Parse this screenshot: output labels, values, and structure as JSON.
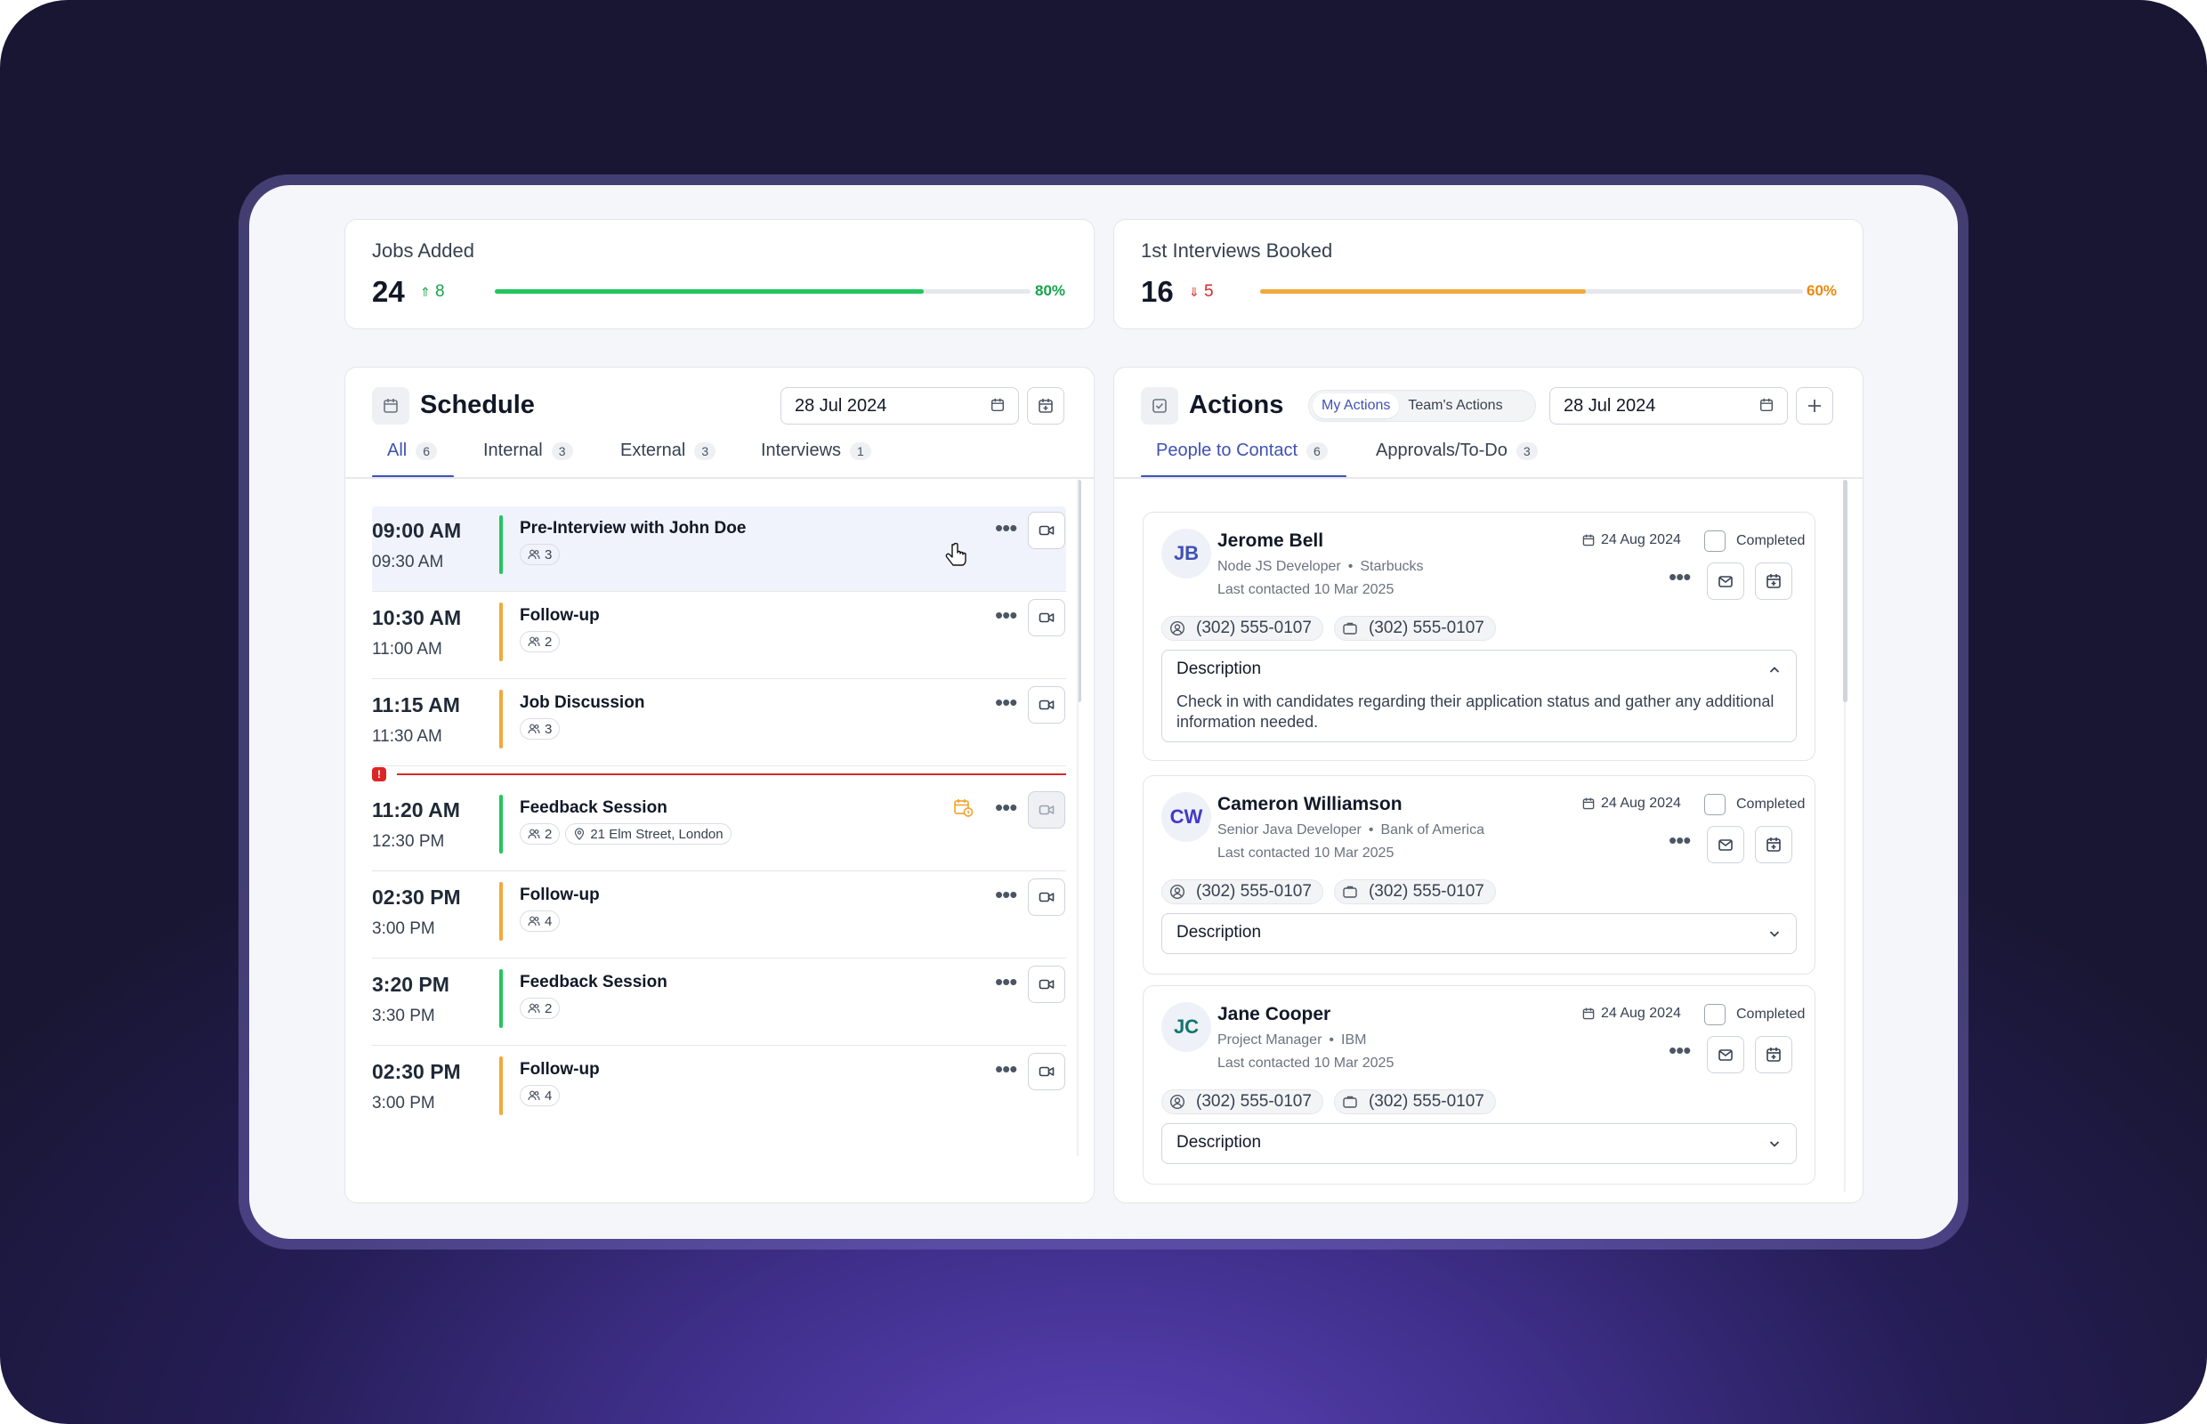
{
  "stats": [
    {
      "label": "Jobs Added",
      "value": "24",
      "delta": "8",
      "delta_dir": "up",
      "pct": "80%",
      "pct_value": 0.8,
      "color": "#22c55e"
    },
    {
      "label": "1st Interviews Booked",
      "value": "16",
      "delta": "5",
      "delta_dir": "down",
      "pct": "60%",
      "pct_value": 0.6,
      "color": "#f0a93b"
    }
  ],
  "schedule": {
    "title": "Schedule",
    "date": "28 Jul 2024",
    "tabs": [
      {
        "label": "All",
        "count": "6",
        "active": true
      },
      {
        "label": "Internal",
        "count": "3"
      },
      {
        "label": "External",
        "count": "3"
      },
      {
        "label": "Interviews",
        "count": "1"
      }
    ],
    "events": [
      {
        "start": "09:00 AM",
        "end": "09:30 AM",
        "title": "Pre-Interview with John Doe",
        "attendees": "3",
        "color": "#22c55e",
        "highlight": true
      },
      {
        "start": "10:30 AM",
        "end": "11:00 AM",
        "title": "Follow-up",
        "attendees": "2",
        "color": "#f0a93b"
      },
      {
        "start": "11:15 AM",
        "end": "11:30 AM",
        "title": "Job Discussion",
        "attendees": "3",
        "color": "#f0a93b"
      },
      {
        "start": "11:20 AM",
        "end": "12:30 PM",
        "title": "Feedback Session",
        "attendees": "2",
        "location": "21 Elm Street, London",
        "color": "#22c55e",
        "has_calendar_alert": true,
        "video_disabled": true
      },
      {
        "start": "02:30 PM",
        "end": "3:00 PM",
        "title": "Follow-up",
        "attendees": "4",
        "color": "#f0a93b"
      },
      {
        "start": "3:20 PM",
        "end": "3:30 PM",
        "title": "Feedback Session",
        "attendees": "2",
        "color": "#22c55e"
      },
      {
        "start": "02:30 PM",
        "end": "3:00 PM",
        "title": "Follow-up",
        "attendees": "4",
        "color": "#f0a93b"
      }
    ]
  },
  "actions": {
    "title": "Actions",
    "toggle": [
      "My Actions",
      "Team's Actions"
    ],
    "date": "28 Jul 2024",
    "tabs": [
      {
        "label": "People to Contact",
        "count": "6",
        "active": true
      },
      {
        "label": "Approvals/To-Do",
        "count": "3"
      }
    ],
    "people": [
      {
        "initials": "JB",
        "initials_color": "#3f51b5",
        "name": "Jerome Bell",
        "role": "Node JS Developer",
        "company": "Starbucks",
        "last_contacted": "Last contacted 10 Mar 2025",
        "due": "24 Aug 2024",
        "completed_label": "Completed",
        "phone1": "(302) 555-0107",
        "phone2": "(302) 555-0107",
        "desc_label": "Description",
        "desc_text": "Check in with candidates regarding their application status and gather any additional information needed.",
        "expanded": true
      },
      {
        "initials": "CW",
        "initials_color": "#4338ca",
        "name": "Cameron Williamson",
        "role": "Senior Java Developer",
        "company": "Bank of America",
        "last_contacted": "Last contacted 10 Mar 2025",
        "due": "24 Aug 2024",
        "completed_label": "Completed",
        "phone1": "(302) 555-0107",
        "phone2": "(302) 555-0107",
        "desc_label": "Description",
        "expanded": false
      },
      {
        "initials": "JC",
        "initials_color": "#0f766e",
        "name": "Jane Cooper",
        "role": "Project Manager",
        "company": "IBM",
        "last_contacted": "Last contacted 10 Mar 2025",
        "due": "24 Aug 2024",
        "completed_label": "Completed",
        "phone1": "(302) 555-0107",
        "phone2": "(302) 555-0107",
        "desc_label": "Description",
        "expanded": false
      }
    ]
  }
}
